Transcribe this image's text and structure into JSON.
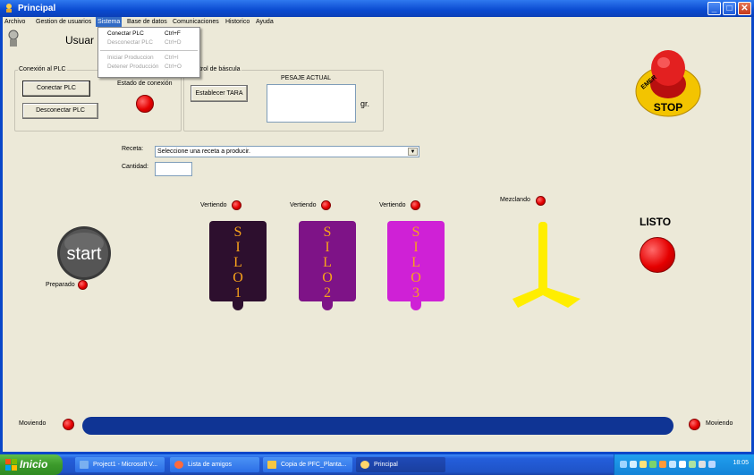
{
  "window": {
    "title": "Principal"
  },
  "menubar": [
    "Archivo",
    "Gestion de usuarios",
    "Sistema",
    "Base de datos",
    "Comunicaciones",
    "Historico",
    "Ayuda"
  ],
  "dropdown": {
    "items": [
      {
        "label": "Conectar PLC",
        "shortcut": "Ctrl+F"
      },
      {
        "label": "Desconectar PLC",
        "shortcut": "Ctrl+D"
      },
      {
        "label": "Iniciar Produccion",
        "shortcut": "Ctrl+I"
      },
      {
        "label": "Detener Producción",
        "shortcut": "Ctrl+O"
      }
    ]
  },
  "user_label": "Usuar",
  "conexion": {
    "title": "Conexión al PLC",
    "connect_label": "Conectar PLC",
    "disconnect_label": "Desconectar PLC",
    "status_label": "Estado de conexión"
  },
  "bascula": {
    "title": "trol de báscula",
    "tara_label": "Establecer TARA",
    "pesaje_label": "PESAJE ACTUAL",
    "unit": "gr."
  },
  "receta": {
    "label": "Receta:",
    "selected": "Seleccione una receta a producir.",
    "cantidad_label": "Cantidad:"
  },
  "start": {
    "label": "start",
    "preparado": "Preparado"
  },
  "silos": [
    {
      "status": "Vertiendo",
      "letters": [
        "S",
        "I",
        "L",
        "O",
        "1"
      ],
      "color": "#2d0f2e"
    },
    {
      "status": "Vertiendo",
      "letters": [
        "S",
        "I",
        "L",
        "O",
        "2"
      ],
      "color": "#7e1387"
    },
    {
      "status": "Vertiendo",
      "letters": [
        "S",
        "I",
        "L",
        "O",
        "3"
      ],
      "color": "#cf21d6"
    }
  ],
  "mixer": {
    "status": "Mezclando"
  },
  "listo": {
    "label": "LISTO"
  },
  "emergency": {
    "text": "EMERGENCY STOP"
  },
  "conveyor": {
    "left_label": "Moviendo",
    "right_label": "Moviendo"
  },
  "taskbar": {
    "start_label": "Inicio",
    "tasks": [
      {
        "label": "Project1 - Microsoft V...",
        "icon_color": "#7ab0f0"
      },
      {
        "label": "Lista de amigos",
        "icon_color": "#ff6a3d"
      },
      {
        "label": "Copia de PFC_Planta...",
        "icon_color": "#f6c743"
      },
      {
        "label": "Principal",
        "icon_color": "#ffd56b"
      }
    ],
    "clock": "18:05"
  }
}
